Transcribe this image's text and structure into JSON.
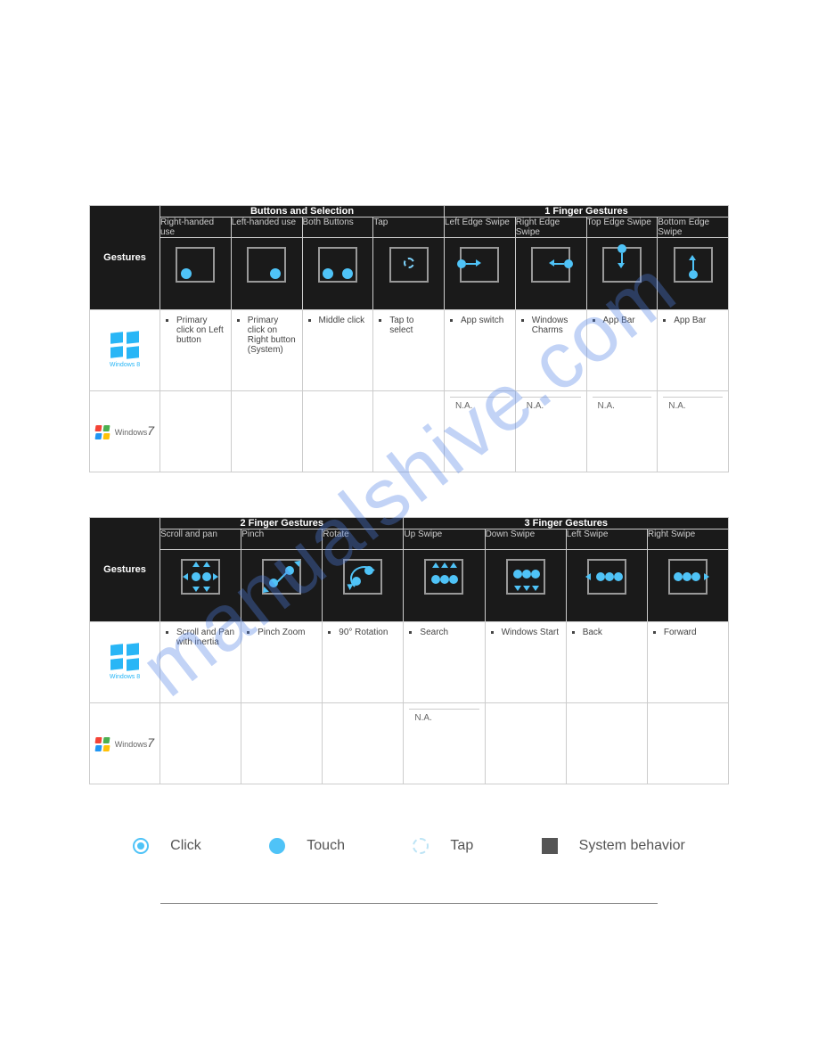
{
  "watermark": "manualshive.com",
  "table1": {
    "row_label": "Gestures",
    "groups": [
      {
        "title": "Buttons and Selection",
        "span": 4
      },
      {
        "title": "1 Finger Gestures",
        "span": 4
      }
    ],
    "columns": [
      "Right-handed use",
      "Left-handed use",
      "Both Buttons",
      "Tap",
      "Left Edge Swipe",
      "Right Edge Swipe",
      "Top Edge Swipe",
      "Bottom Edge Swipe"
    ],
    "win8": [
      "Primary click on Left button",
      "Primary click on Right button (System)",
      "Middle click",
      "Tap to select",
      "App switch",
      "Windows Charms",
      "App Bar",
      "App Bar"
    ],
    "win7_na": [
      "",
      "",
      "",
      "",
      "N.A.",
      "N.A.",
      "N.A.",
      "N.A."
    ]
  },
  "table2": {
    "row_label": "Gestures",
    "groups": [
      {
        "title": "2 Finger Gestures",
        "span": 3
      },
      {
        "title": "3 Finger Gestures",
        "span": 4
      }
    ],
    "columns": [
      "Scroll and pan",
      "Pinch",
      "Rotate",
      "Up Swipe",
      "Down Swipe",
      "Left Swipe",
      "Right Swipe"
    ],
    "win8": [
      "Scroll and Pan with inertia",
      "Pinch Zoom",
      "90° Rotation",
      "Search",
      "Windows Start",
      "Back",
      "Forward"
    ],
    "win7_na": [
      "",
      "",
      "",
      "N.A.",
      "",
      "",
      ""
    ]
  },
  "os_labels": {
    "win8": "Windows 8",
    "win7_prefix": "Windows",
    "win7_suffix": "7"
  },
  "legend": {
    "click": "Click",
    "touch": "Touch",
    "tap": "Tap",
    "system": "System behavior"
  }
}
